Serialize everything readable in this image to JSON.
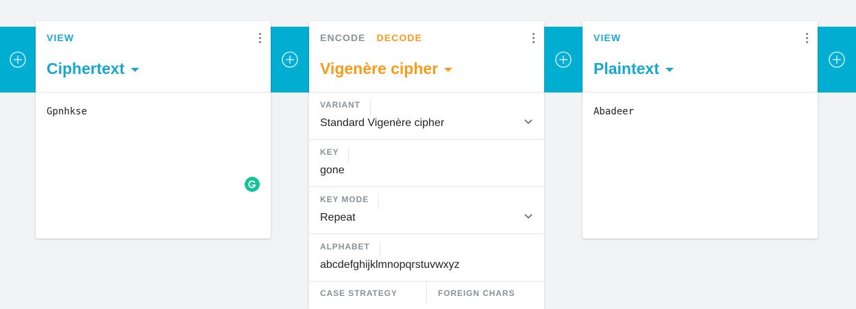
{
  "colors": {
    "accent": "#00aed1",
    "title_blue": "#1ba7cc",
    "title_orange": "#f59b1e",
    "background": "#f2f3f5"
  },
  "left_card": {
    "tab": "VIEW",
    "title": "Ciphertext",
    "content": "Gpnhkse"
  },
  "middle_card": {
    "tabs": {
      "encode": "ENCODE",
      "decode": "DECODE"
    },
    "title": "Vigenère cipher",
    "fields": {
      "variant": {
        "label": "VARIANT",
        "value": "Standard Vigenère cipher"
      },
      "key": {
        "label": "KEY",
        "value": "gone"
      },
      "key_mode": {
        "label": "KEY MODE",
        "value": "Repeat"
      },
      "alphabet": {
        "label": "ALPHABET",
        "value": "abcdefghijklmnopqrstuvwxyz"
      },
      "case_strategy": {
        "label": "CASE STRATEGY"
      },
      "foreign_chars": {
        "label": "FOREIGN CHARS"
      }
    }
  },
  "right_card": {
    "tab": "VIEW",
    "title": "Plaintext",
    "content": "Abadeer"
  },
  "icons": {
    "add": "plus-circle-icon",
    "menu": "kebab-menu-icon",
    "dropdown": "chevron-down-icon",
    "title_caret": "caret-down-icon",
    "grammarly": "grammarly-icon"
  }
}
